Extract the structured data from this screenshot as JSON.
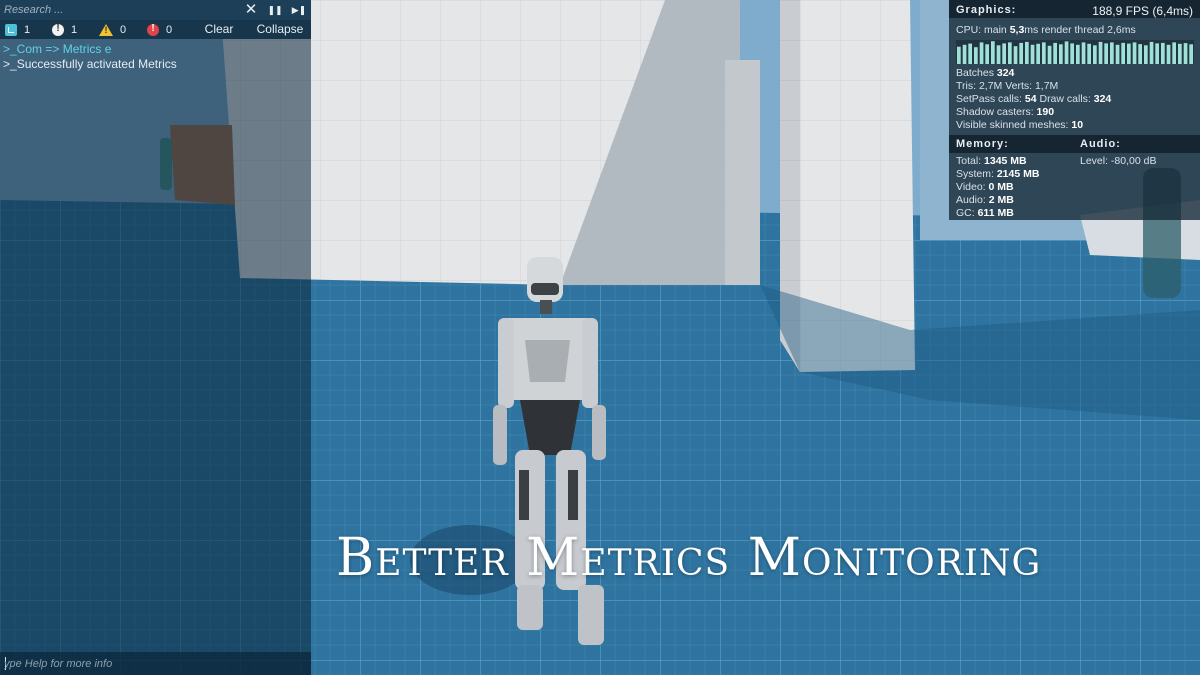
{
  "console": {
    "search_placeholder": "Research ...",
    "counters": {
      "log": "1",
      "info": "1",
      "warning": "0",
      "error": "0"
    },
    "buttons": {
      "clear": "Clear",
      "collapse": "Collapse"
    },
    "log_lines": [
      {
        "prefix": ">_Com => ",
        "text": "Metrics e"
      },
      {
        "prefix": ">_",
        "text": "Successfully activated Metrics"
      }
    ],
    "input_placeholder": "ype Help for more info"
  },
  "metrics": {
    "graphics": {
      "title": "Graphics:",
      "fps": "188,9 FPS (6,4ms)",
      "cpu_prefix": "CPU: main ",
      "cpu_main": "5,3",
      "cpu_suffix": "ms render thread 2,6ms",
      "batches_label": "Batches ",
      "batches": "324",
      "tris_line": "Tris: 2,7M Verts: 1,7M",
      "setpass_label": "SetPass calls: ",
      "setpass": "54",
      "drawcalls_label": " Draw calls: ",
      "drawcalls": "324",
      "shadow_label": "Shadow casters: ",
      "shadow": "190",
      "skinned_label": "Visible skinned meshes: ",
      "skinned": "10"
    },
    "fps_history": [
      0.72,
      0.8,
      0.85,
      0.7,
      0.9,
      0.82,
      0.95,
      0.78,
      0.86,
      0.9,
      0.74,
      0.88,
      0.92,
      0.8,
      0.84,
      0.9,
      0.76,
      0.88,
      0.82,
      0.94,
      0.86,
      0.8,
      0.9,
      0.84,
      0.78,
      0.92,
      0.86,
      0.9,
      0.8,
      0.88,
      0.85,
      0.9,
      0.83,
      0.78,
      0.92,
      0.86,
      0.88,
      0.8,
      0.9,
      0.84,
      0.87,
      0.82
    ],
    "memory": {
      "title": "Memory:",
      "total_label": "Total: ",
      "total": "1345 MB",
      "system_label": "System: ",
      "system": "2145 MB",
      "video_label": "Video: ",
      "video": "0 MB",
      "audio_label": "Audio: ",
      "audio": "2 MB",
      "gc_label": "GC: ",
      "gc": "611 MB"
    },
    "audio": {
      "title": "Audio:",
      "level": "Level: -80,00 dB"
    }
  },
  "overlay_title": "Better Metrics Monitoring",
  "colors": {
    "accent": "#5fd2e8",
    "fps_bar": "#9fe0d8",
    "floor": "#2e6b93"
  }
}
